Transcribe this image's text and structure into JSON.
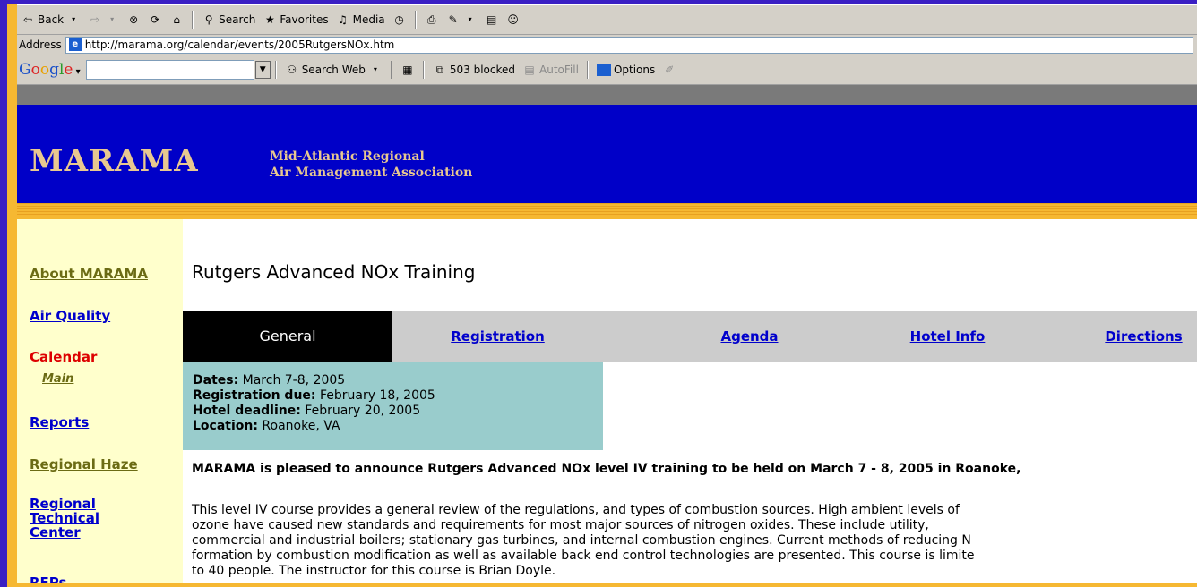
{
  "browser": {
    "toolbar": {
      "back": "Back",
      "search": "Search",
      "favorites": "Favorites",
      "media": "Media"
    },
    "address": {
      "label": "Address",
      "url": "http://marama.org/calendar/events/2005RutgersNOx.htm"
    },
    "google_bar": {
      "search_web": "Search Web",
      "blocked": "503 blocked",
      "autofill": "AutoFill",
      "options": "Options"
    }
  },
  "site": {
    "logo": "MARAMA",
    "subtitle_line1": "Mid-Atlantic Regional",
    "subtitle_line2": "Air Management Association"
  },
  "sidebar": {
    "about": "About MARAMA",
    "air_quality": "Air Quality",
    "calendar": "Calendar",
    "main": "Main",
    "reports": "Reports",
    "regional_haze": "Regional Haze",
    "rtc_line1": "Regional",
    "rtc_line2": "Technical",
    "rtc_line3": "Center",
    "rfps": "RFPs"
  },
  "page": {
    "title": "Rutgers Advanced NOx Training",
    "tabs": [
      "General",
      "Registration",
      "Agenda",
      "Hotel Info",
      "Directions"
    ],
    "info": {
      "dates_label": "Dates:",
      "dates_value": " March 7-8, 2005",
      "reg_label": "Registration due:",
      "reg_value": " February 18, 2005",
      "hotel_label": "Hotel deadline:",
      "hotel_value": " February 20, 2005",
      "loc_label": "Location:",
      "loc_value": " Roanoke, VA"
    },
    "announcement": "MARAMA is pleased to announce Rutgers Advanced NOx level IV training to be held on March 7 - 8, 2005 in Roanoke,",
    "paragraph": [
      "This level IV course provides a general review of the regulations, and types of combustion sources. High ambient levels of",
      "ozone have caused new standards and requirements for most major sources of nitrogen oxides. These include utility,",
      "commercial and industrial boilers; stationary gas turbines, and internal combustion engines. Current methods of reducing N",
      "formation by combustion modification as well as available back end control technologies are presented. This course is limite",
      "to 40 people. The instructor for this course is Brian Doyle."
    ]
  }
}
